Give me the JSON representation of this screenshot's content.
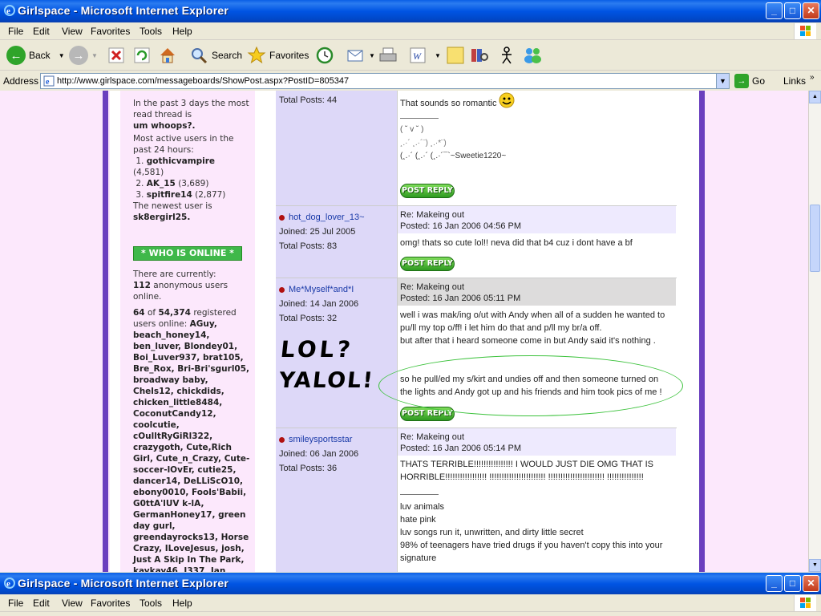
{
  "window": {
    "title": "Girlspace - Microsoft Internet Explorer",
    "min": "_",
    "max": "□",
    "close": "✕"
  },
  "menu": [
    "File",
    "Edit",
    "View",
    "Favorites",
    "Tools",
    "Help"
  ],
  "toolbar": {
    "back": "Back",
    "search": "Search",
    "favorites": "Favorites"
  },
  "address": {
    "label": "Address",
    "url": "http://www.girlspace.com/messageboards/ShowPost.aspx?PostID=805347",
    "go": "Go",
    "links": "Links"
  },
  "sidebar": {
    "read_thread_text": "In the past 3 days the most read thread is",
    "read_thread_name": "um whoops?.",
    "active_text": "Most active users in the past 24 hours:",
    "active_users": [
      {
        "rank": "1.",
        "name": "gothicvampire",
        "count": "(4,581)"
      },
      {
        "rank": "2.",
        "name": "AK_15",
        "count": "(3,689)"
      },
      {
        "rank": "3.",
        "name": "spitfire14",
        "count": "(2,877)"
      }
    ],
    "newest_text": "The newest user is",
    "newest_user": "sk8ergirl25.",
    "who_online": "* WHO IS ONLINE *",
    "currently_text": "There are currently:",
    "anon_count": "112",
    "anon_text": "anonymous users online.",
    "reg_count": "64",
    "reg_of": "of",
    "reg_total": "54,374",
    "reg_text": "registered users online:",
    "online_list": "AGuy, beach_honey14, ben_luver, Blondey01, Boi_Luver937, brat105, Bre_Rox, Bri-Bri'sgurl05, broadway baby, Chels12, chickdids, chicken_little8484, CoconutCandy12, coolcutie, cOulltRyGiRl322, crazygoth, Cute,Rich Girl, Cute_n_Crazy, Cute-soccer-lOvEr, cutie25, dancer14, DeLLiScO10, ebony0010, Fools'Babii, G0ttA'lUV k-lA, GermanHoney17, green day gurl, greendayrocks13, Horse Crazy, ILoveJesus, josh, Just A Skip In The Park, kaykay46, I337, Jan"
  },
  "posts": [
    {
      "author_total": "Total Posts: 44",
      "text": "That sounds so romantic",
      "sig_line1": "( ˘ v ˘ )",
      "sig_line2": "¸.·´ ¸.·´¨) ¸.·*¨)",
      "sig_line3": "(¸.·´ (¸.·´ (¸.·´¯`~Sweetie1220~",
      "reply": "POST REPLY"
    },
    {
      "author": "hot_dog_lover_13~",
      "joined": "Joined: 25 Jul 2005",
      "total": "Total Posts: 83",
      "subject": "Re: Makeing out",
      "posted": "Posted: 16 Jan 2006 04:56 PM",
      "text": "omg! thats so cute lol!! neva did that b4 cuz i dont have a bf",
      "reply": "POST REPLY"
    },
    {
      "author": "Me*Myself*and*I",
      "joined": "Joined: 14 Jan 2006",
      "total": "Total Posts: 32",
      "subject": "Re: Makeing out",
      "posted": "Posted: 16 Jan 2006 05:11 PM",
      "text1": "well i was mak/ing o/ut with Andy when all of a sudden he wanted to pu/ll my top o/ff! i let him do that and p/ll my br/a off.",
      "text2": "but after that i heard someone come in but Andy said it's nothing .",
      "text3": "so he pull/ed my s/kirt and undies off and then someone turned on the lights and Andy got up and his friends and him took pics of me !",
      "lol1": "LOL?",
      "lol2": "YALOL!",
      "reply": "POST REPLY"
    },
    {
      "author": "smileysportsstar",
      "joined": "Joined: 06 Jan 2006",
      "total": "Total Posts: 36",
      "subject": "Re: Makeing out",
      "posted": "Posted: 16 Jan 2006 05:14 PM",
      "text1": "THATS TERRIBLE!!!!!!!!!!!!!!!! I WOULD JUST DIE OMG THAT IS HORRIBLE!!!!!!!!!!!!!!!!!  !!!!!!!!!!!!!!!!!!!!!!!  !!!!!!!!!!!!!!!!!!!!!!!  !!!!!!!!!!!!!!!",
      "sig1": "luv animals",
      "sig2": "hate pink",
      "sig3": "luv songs run it, unwritten, and dirty little secret",
      "sig4": "98% of teenagers have tried drugs if you haven't copy this into your signature"
    }
  ]
}
